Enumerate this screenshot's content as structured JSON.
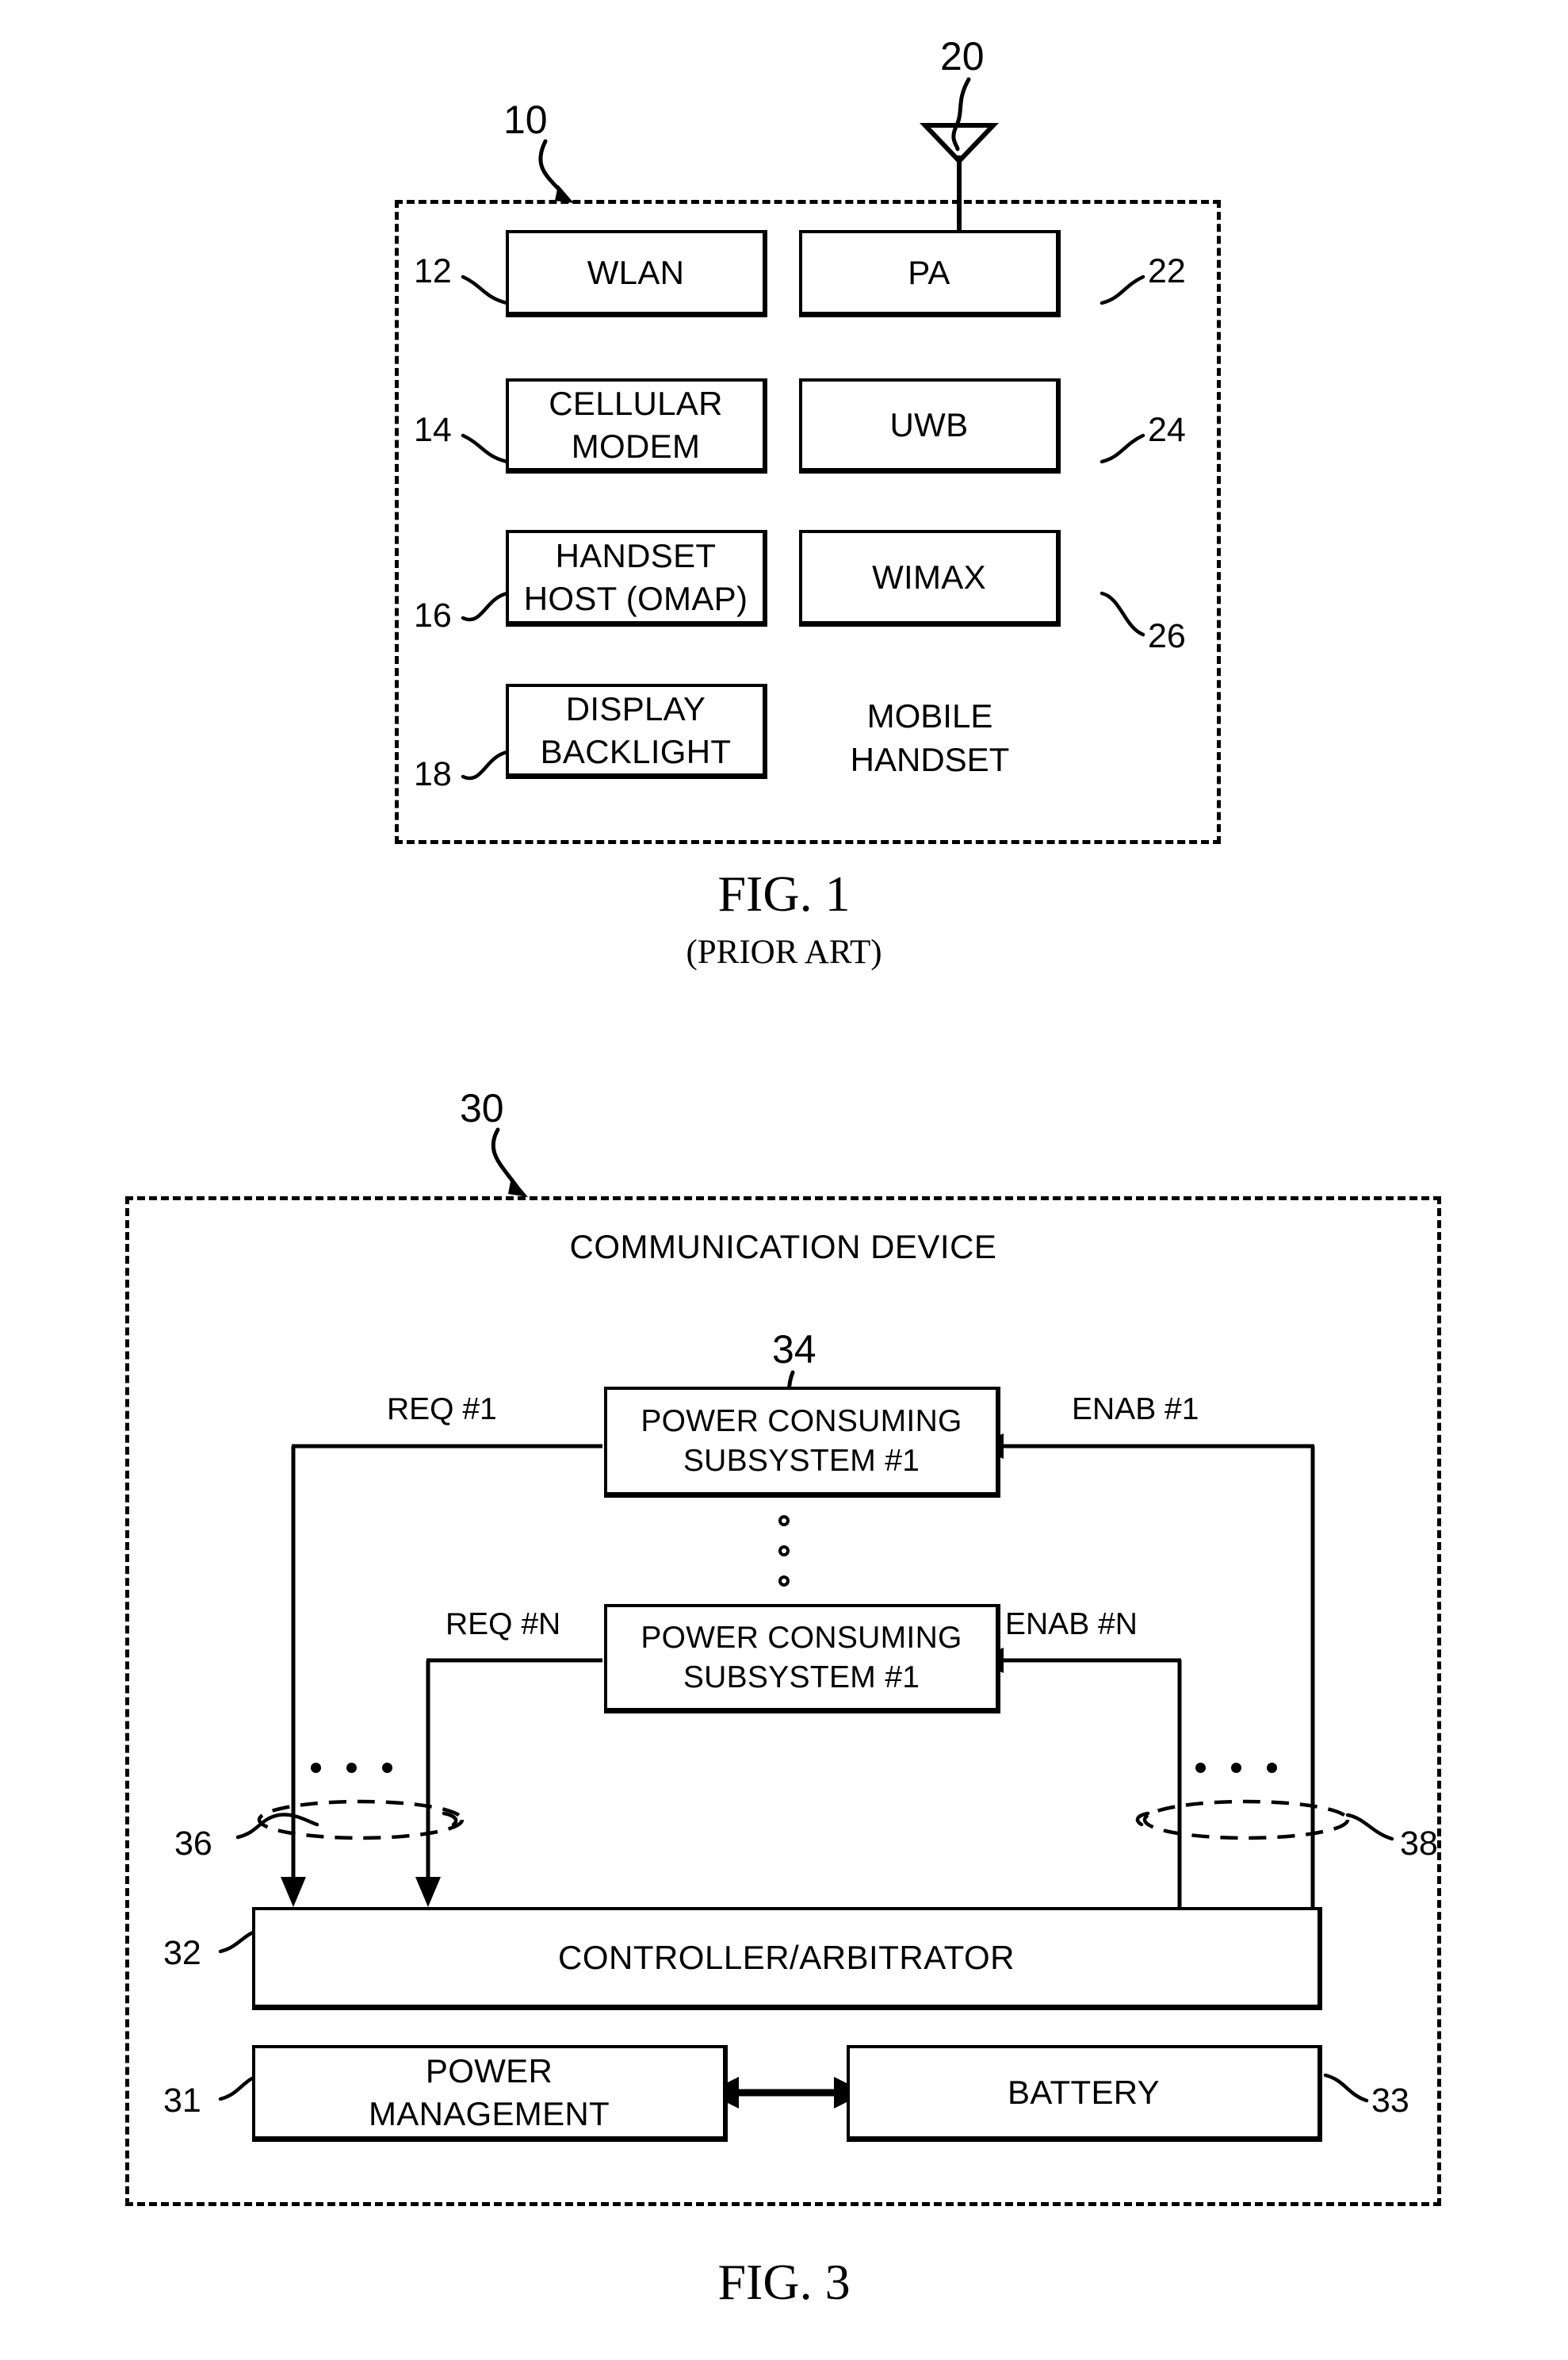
{
  "figure1": {
    "enclosure_ref": "10",
    "antenna_ref": "20",
    "enclosure_label": "MOBILE\nHANDSET",
    "left_blocks": [
      {
        "ref": "12",
        "label": "WLAN"
      },
      {
        "ref": "14",
        "label": "CELLULAR\nMODEM"
      },
      {
        "ref": "16",
        "label": "HANDSET\nHOST (OMAP)"
      },
      {
        "ref": "18",
        "label": "DISPLAY\nBACKLIGHT"
      }
    ],
    "right_blocks": [
      {
        "ref": "22",
        "label": "PA"
      },
      {
        "ref": "24",
        "label": "UWB"
      },
      {
        "ref": "26",
        "label": "WIMAX"
      }
    ],
    "caption": "FIG. 1",
    "subcaption": "(PRIOR ART)"
  },
  "figure3": {
    "enclosure_ref": "30",
    "enclosure_title": "COMMUNICATION DEVICE",
    "subsystems": [
      {
        "ref": "34",
        "label": "POWER CONSUMING\nSUBSYSTEM #1",
        "request_label": "REQ #1",
        "enable_label": "ENAB #1"
      },
      {
        "ref": "",
        "label": "POWER CONSUMING\nSUBSYSTEM #1",
        "request_label": "REQ #N",
        "enable_label": "ENAB #N"
      }
    ],
    "request_bus_ref": "36",
    "enable_bus_ref": "38",
    "controller": {
      "ref": "32",
      "label": "CONTROLLER/ARBITRATOR"
    },
    "power_management": {
      "ref": "31",
      "label": "POWER\nMANAGEMENT"
    },
    "battery": {
      "ref": "33",
      "label": "BATTERY"
    },
    "caption": "FIG. 3"
  },
  "colors": {
    "ink": "#000000",
    "paper": "#ffffff"
  }
}
